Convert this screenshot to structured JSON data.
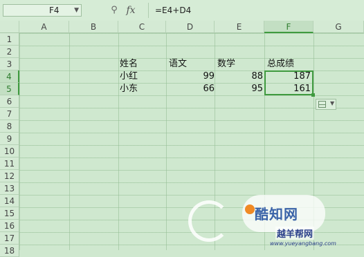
{
  "formula_bar": {
    "name_box": "F4",
    "fx": "fx",
    "formula": "=E4+D4"
  },
  "columns": [
    "A",
    "B",
    "C",
    "D",
    "E",
    "F",
    "G"
  ],
  "rows": [
    "1",
    "2",
    "3",
    "4",
    "5",
    "6",
    "7",
    "8",
    "9",
    "10",
    "11",
    "12",
    "13",
    "14",
    "15",
    "16",
    "17",
    "18"
  ],
  "table": {
    "headers": [
      "姓名",
      "语文",
      "数学",
      "总成绩"
    ],
    "rows": [
      {
        "name": "小红",
        "chinese": "99",
        "math": "88",
        "total": "187"
      },
      {
        "name": "小东",
        "chinese": "66",
        "math": "95",
        "total": "161"
      }
    ]
  },
  "watermark": {
    "brand": "酷知网",
    "sub": "越羊帮网",
    "url": "www.yueyangbang.com"
  },
  "colors": {
    "selection": "#3f9a3f",
    "background": "#cfe8cf"
  }
}
